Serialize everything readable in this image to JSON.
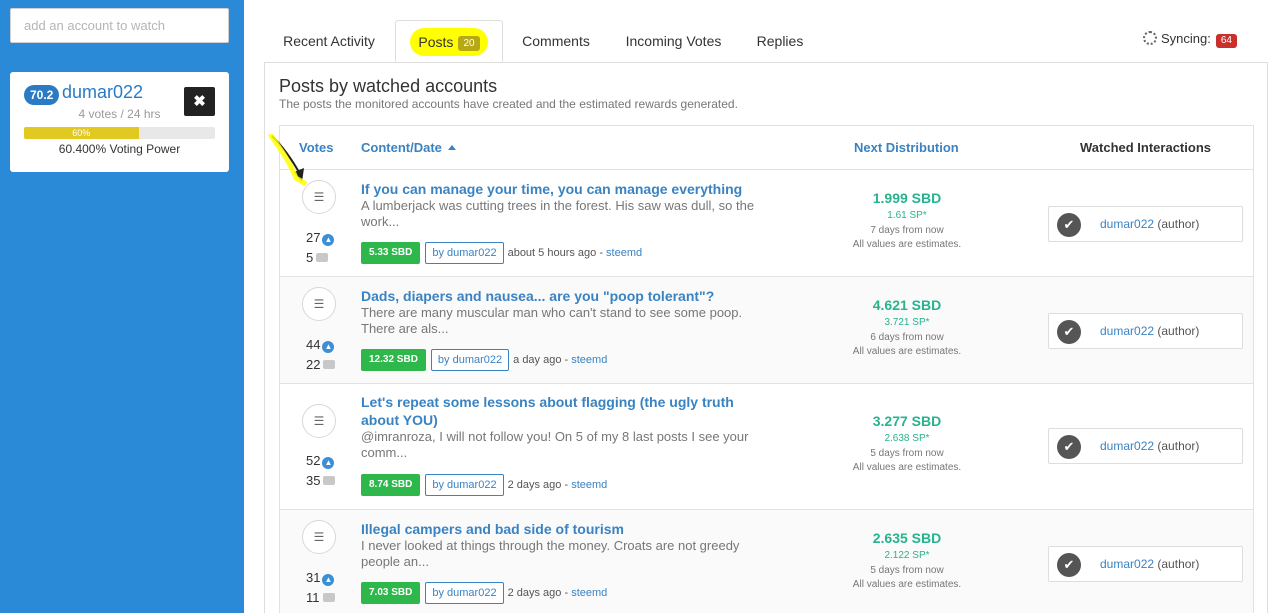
{
  "sidebar": {
    "watch_placeholder": "add an account to watch",
    "account": {
      "reputation": "70.2",
      "name": "dumar022",
      "votes_summary": "4 votes / 24 hrs",
      "close_label": "✖",
      "voting_power_bar_label": "60%",
      "voting_power_fraction": 0.6,
      "voting_power_text": "60.400% Voting Power"
    }
  },
  "tabs": [
    {
      "label": "Recent Activity"
    },
    {
      "label": "Posts",
      "count": "20"
    },
    {
      "label": "Comments"
    },
    {
      "label": "Incoming Votes"
    },
    {
      "label": "Replies"
    }
  ],
  "sync": {
    "label": "Syncing:",
    "count": "64"
  },
  "panel": {
    "title": "Posts by watched accounts",
    "subtitle": "The posts the monitored accounts have created and the estimated rewards generated."
  },
  "table": {
    "headers": {
      "votes": "Votes",
      "content": "Content/Date",
      "distribution": "Next Distribution",
      "interactions": "Watched Interactions"
    },
    "rows": [
      {
        "title": "If you can manage your time, you can manage everything",
        "excerpt": "A lumberjack was cutting trees in the forest. His saw was dull, so the work...",
        "votes": "27",
        "comments": "5",
        "payout": "5.33 SBD",
        "author_label": "by dumar022",
        "time": "about 5 hours ago",
        "source": "steemd",
        "next_sbd": "1.999 SBD",
        "next_sp": "1.61 SP*",
        "days": "7 days from now",
        "estimate_note": "All values are estimates.",
        "interaction_name": "dumar022",
        "interaction_role": "(author)"
      },
      {
        "title": "Dads, diapers and nausea... are you \"poop tolerant\"?",
        "excerpt": "There are many muscular man who can't stand to see some poop. There are als...",
        "votes": "44",
        "comments": "22",
        "payout": "12.32 SBD",
        "author_label": "by dumar022",
        "time": "a day ago",
        "source": "steemd",
        "next_sbd": "4.621 SBD",
        "next_sp": "3.721 SP*",
        "days": "6 days from now",
        "estimate_note": "All values are estimates.",
        "interaction_name": "dumar022",
        "interaction_role": "(author)"
      },
      {
        "title": "Let's repeat some lessons about flagging (the ugly truth about YOU)",
        "excerpt": "@imranroza, I will not follow you! On 5 of my 8 last posts I see your comm...",
        "votes": "52",
        "comments": "35",
        "payout": "8.74 SBD",
        "author_label": "by dumar022",
        "time": "2 days ago",
        "source": "steemd",
        "next_sbd": "3.277 SBD",
        "next_sp": "2.638 SP*",
        "days": "5 days from now",
        "estimate_note": "All values are estimates.",
        "interaction_name": "dumar022",
        "interaction_role": "(author)"
      },
      {
        "title": "Illegal campers and bad side of tourism",
        "excerpt": "I never looked at things through the money. Croats are not greedy people an...",
        "votes": "31",
        "comments": "11",
        "payout": "7.03 SBD",
        "author_label": "by dumar022",
        "time": "2 days ago",
        "source": "steemd",
        "next_sbd": "2.635 SBD",
        "next_sp": "2.122 SP*",
        "days": "5 days from now",
        "estimate_note": "All values are estimates.",
        "interaction_name": "dumar022",
        "interaction_role": "(author)"
      }
    ]
  }
}
